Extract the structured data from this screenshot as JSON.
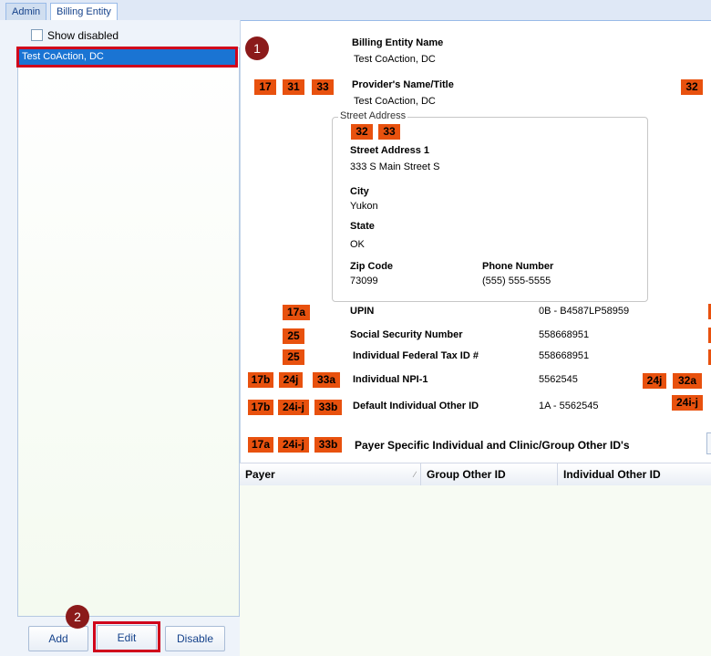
{
  "tabs": [
    {
      "label": "Admin"
    },
    {
      "label": "Billing Entity"
    }
  ],
  "left": {
    "show_disabled_label": "Show disabled",
    "selected_item": "Test CoAction, DC",
    "buttons": {
      "add": "Add",
      "edit": "Edit",
      "disable": "Disable"
    }
  },
  "callouts": [
    "1",
    "2"
  ],
  "form": {
    "entity_name_label": "Billing Entity Name",
    "entity_name_value": "Test CoAction, DC",
    "provider_label": "Provider's Name/Title",
    "provider_value": "Test CoAction, DC",
    "provider_tags": [
      "17",
      "31",
      "33"
    ],
    "provider_tag_right": "32",
    "address": {
      "legend": "Street Address",
      "tags": [
        "32",
        "33"
      ],
      "street_label": "Street Address 1",
      "street_value": "333 S Main Street S",
      "city_label": "City",
      "city_value": "Yukon",
      "state_label": "State",
      "state_value": "OK",
      "zip_label": "Zip Code",
      "zip_value": "73099",
      "phone_label": "Phone Number",
      "phone_value": "(555) 555-5555"
    },
    "upin": {
      "tag": "17a",
      "label": "UPIN",
      "value": "0B - B4587LP58959"
    },
    "ssn": {
      "tag": "25",
      "label": "Social Security Number",
      "value": "558668951"
    },
    "taxid": {
      "tag": "25",
      "label": "Individual Federal Tax ID #",
      "value": "558668951"
    },
    "npi": {
      "tags": [
        "17b",
        "24j",
        "33a"
      ],
      "label": "Individual NPI-1",
      "value": "5562545",
      "right_tags": [
        "24j",
        "32a"
      ]
    },
    "otherid": {
      "tags": [
        "17b",
        "24i-j",
        "33b"
      ],
      "label": "Default Individual Other ID",
      "value": "1A - 5562545",
      "right_tag": "24i-j"
    },
    "payer_specific": {
      "tags": [
        "17a",
        "24i-j",
        "33b"
      ],
      "label": "Payer Specific Individual and Clinic/Group Other ID's"
    }
  },
  "grid": {
    "columns": [
      "Payer",
      "Group Other ID",
      "Individual Other ID"
    ]
  },
  "colors": {
    "tag": "#e8510e",
    "selection": "#1a74d3",
    "callout": "#8b1a1a",
    "highlight": "#d0021b"
  }
}
